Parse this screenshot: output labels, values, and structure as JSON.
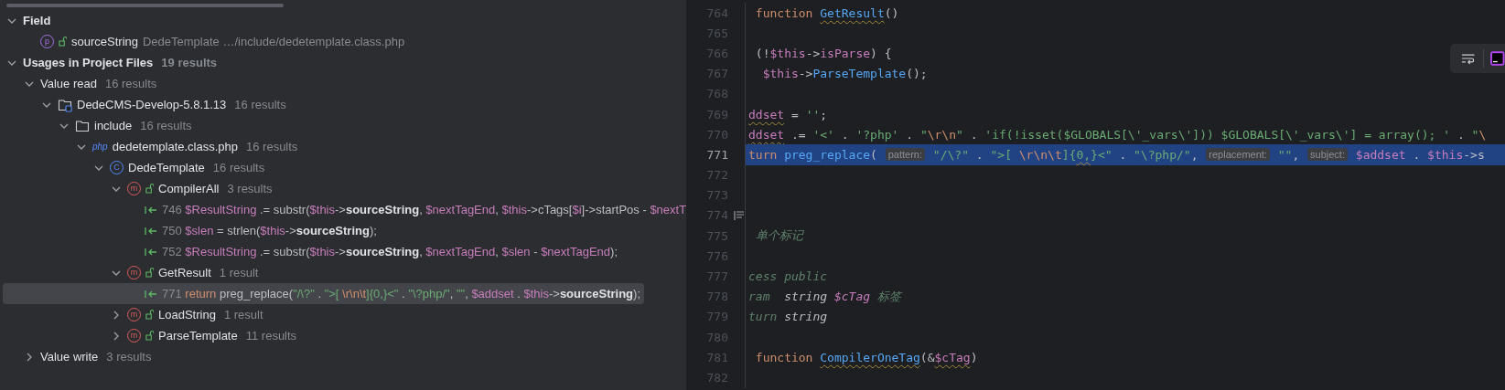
{
  "usages_tree": [
    {
      "kind": "header",
      "label": "Field",
      "expanded": true,
      "selected": false,
      "children": [
        {
          "kind": "field",
          "badge": "p",
          "label": "sourceString",
          "detail": "DedeTemplate …/include/dedetemplate.class.php",
          "selected": false
        }
      ]
    },
    {
      "kind": "header",
      "label": "Usages in Project Files",
      "count": "19 results",
      "expanded": true,
      "selected": false,
      "children": [
        {
          "kind": "group",
          "label": "Value read",
          "count": "16 results",
          "expanded": true,
          "selected": false,
          "children": [
            {
              "kind": "module",
              "label": "DedeCMS-Develop-5.8.1.13",
              "count": "16 results",
              "expanded": true,
              "selected": false,
              "children": [
                {
                  "kind": "folder",
                  "label": "include",
                  "count": "16 results",
                  "expanded": true,
                  "selected": false,
                  "children": [
                    {
                      "kind": "php-file",
                      "badge": "php",
                      "label": "dedetemplate.class.php",
                      "count": "16 results",
                      "expanded": true,
                      "selected": false,
                      "children": [
                        {
                          "kind": "class",
                          "badge": "C",
                          "label": "DedeTemplate",
                          "count": "16 results",
                          "expanded": true,
                          "selected": false,
                          "children": [
                            {
                              "kind": "method",
                              "badge": "m",
                              "label": "CompilerAll",
                              "count": "3 results",
                              "expanded": true,
                              "selected": false,
                              "children": [
                                {
                                  "kind": "usage",
                                  "line": "746",
                                  "selected": false,
                                  "tokens": [
                                    {
                                      "kind": "var",
                                      "text": "$ResultString"
                                    },
                                    {
                                      "kind": "plain",
                                      "text": " .= substr("
                                    },
                                    {
                                      "kind": "var",
                                      "text": "$this"
                                    },
                                    {
                                      "kind": "plain",
                                      "text": "->"
                                    },
                                    {
                                      "kind": "bold",
                                      "text": "sourceString"
                                    },
                                    {
                                      "kind": "plain",
                                      "text": ", "
                                    },
                                    {
                                      "kind": "var",
                                      "text": "$nextTagEnd"
                                    },
                                    {
                                      "kind": "plain",
                                      "text": ", "
                                    },
                                    {
                                      "kind": "var",
                                      "text": "$this"
                                    },
                                    {
                                      "kind": "plain",
                                      "text": "->cTags["
                                    },
                                    {
                                      "kind": "var",
                                      "text": "$i"
                                    },
                                    {
                                      "kind": "plain",
                                      "text": "]->startPos - "
                                    },
                                    {
                                      "kind": "var",
                                      "text": "$nextT"
                                    }
                                  ]
                                },
                                {
                                  "kind": "usage",
                                  "line": "750",
                                  "selected": false,
                                  "tokens": [
                                    {
                                      "kind": "var",
                                      "text": "$slen"
                                    },
                                    {
                                      "kind": "plain",
                                      "text": " = strlen("
                                    },
                                    {
                                      "kind": "var",
                                      "text": "$this"
                                    },
                                    {
                                      "kind": "plain",
                                      "text": "->"
                                    },
                                    {
                                      "kind": "bold",
                                      "text": "sourceString"
                                    },
                                    {
                                      "kind": "plain",
                                      "text": ");"
                                    }
                                  ]
                                },
                                {
                                  "kind": "usage",
                                  "line": "752",
                                  "selected": false,
                                  "tokens": [
                                    {
                                      "kind": "var",
                                      "text": "$ResultString"
                                    },
                                    {
                                      "kind": "plain",
                                      "text": " .= substr("
                                    },
                                    {
                                      "kind": "var",
                                      "text": "$this"
                                    },
                                    {
                                      "kind": "plain",
                                      "text": "->"
                                    },
                                    {
                                      "kind": "bold",
                                      "text": "sourceString"
                                    },
                                    {
                                      "kind": "plain",
                                      "text": ", "
                                    },
                                    {
                                      "kind": "var",
                                      "text": "$nextTagEnd"
                                    },
                                    {
                                      "kind": "plain",
                                      "text": ", "
                                    },
                                    {
                                      "kind": "var",
                                      "text": "$slen"
                                    },
                                    {
                                      "kind": "plain",
                                      "text": " - "
                                    },
                                    {
                                      "kind": "var",
                                      "text": "$nextTagEnd"
                                    },
                                    {
                                      "kind": "plain",
                                      "text": ");"
                                    }
                                  ]
                                }
                              ]
                            },
                            {
                              "kind": "method",
                              "badge": "m",
                              "label": "GetResult",
                              "count": "1 result",
                              "expanded": true,
                              "selected": false,
                              "children": [
                                {
                                  "kind": "usage",
                                  "line": "771",
                                  "selected": true,
                                  "tokens": [
                                    {
                                      "kind": "kw",
                                      "text": "return"
                                    },
                                    {
                                      "kind": "plain",
                                      "text": " preg_replace("
                                    },
                                    {
                                      "kind": "str",
                                      "text": "\"/\\?\""
                                    },
                                    {
                                      "kind": "plain",
                                      "text": " . "
                                    },
                                    {
                                      "kind": "str",
                                      "text": "\">[ "
                                    },
                                    {
                                      "kind": "esc",
                                      "text": "\\r\\n\\t"
                                    },
                                    {
                                      "kind": "str",
                                      "text": "]{0,}<\""
                                    },
                                    {
                                      "kind": "plain",
                                      "text": " . "
                                    },
                                    {
                                      "kind": "str",
                                      "text": "\"\\?php/\""
                                    },
                                    {
                                      "kind": "plain",
                                      "text": ", "
                                    },
                                    {
                                      "kind": "str",
                                      "text": "\"\""
                                    },
                                    {
                                      "kind": "plain",
                                      "text": ", "
                                    },
                                    {
                                      "kind": "var",
                                      "text": "$addset"
                                    },
                                    {
                                      "kind": "plain",
                                      "text": " . "
                                    },
                                    {
                                      "kind": "var",
                                      "text": "$this"
                                    },
                                    {
                                      "kind": "plain",
                                      "text": "->"
                                    },
                                    {
                                      "kind": "bold",
                                      "text": "sourceString"
                                    },
                                    {
                                      "kind": "plain",
                                      "text": ");"
                                    }
                                  ]
                                }
                              ]
                            },
                            {
                              "kind": "method",
                              "badge": "m",
                              "label": "LoadString",
                              "count": "1 result",
                              "expanded": false,
                              "selected": false
                            },
                            {
                              "kind": "method",
                              "badge": "m",
                              "label": "ParseTemplate",
                              "count": "11 results",
                              "expanded": false,
                              "selected": false
                            }
                          ]
                        }
                      ]
                    }
                  ]
                }
              ]
            }
          ]
        },
        {
          "kind": "group",
          "label": "Value write",
          "count": "3 results",
          "expanded": false,
          "selected": false
        }
      ]
    }
  ],
  "editor": {
    "lines": [
      {
        "number": "764",
        "current": false,
        "tokens": [
          {
            "kind": "kw",
            "text": " function "
          },
          {
            "kind": "fn",
            "text": "GetResult",
            "warn": true
          },
          {
            "kind": "plain",
            "text": "()"
          }
        ]
      },
      {
        "number": "765",
        "current": false
      },
      {
        "number": "766",
        "current": false,
        "tokens": [
          {
            "kind": "plain",
            "text": " (!"
          },
          {
            "kind": "var",
            "text": "$this"
          },
          {
            "kind": "plain",
            "text": "->"
          },
          {
            "kind": "var",
            "text": "isParse"
          },
          {
            "kind": "plain",
            "text": ") {"
          }
        ]
      },
      {
        "number": "767",
        "current": false,
        "tokens": [
          {
            "kind": "var",
            "text": "  $this"
          },
          {
            "kind": "plain",
            "text": "->"
          },
          {
            "kind": "fn",
            "text": "ParseTemplate"
          },
          {
            "kind": "plain",
            "text": "();"
          }
        ]
      },
      {
        "number": "768",
        "current": false
      },
      {
        "number": "769",
        "current": false,
        "tokens": [
          {
            "kind": "var",
            "text": "ddset",
            "warn": true
          },
          {
            "kind": "plain",
            "text": " = "
          },
          {
            "kind": "str",
            "text": "''"
          },
          {
            "kind": "plain",
            "text": ";"
          }
        ]
      },
      {
        "number": "770",
        "current": false,
        "tokens": [
          {
            "kind": "var",
            "text": "ddset",
            "warn": true
          },
          {
            "kind": "plain",
            "text": " .= "
          },
          {
            "kind": "str",
            "text": "'<'"
          },
          {
            "kind": "plain",
            "text": " . "
          },
          {
            "kind": "str",
            "text": "'?php'"
          },
          {
            "kind": "plain",
            "text": " . "
          },
          {
            "kind": "str",
            "text": "\""
          },
          {
            "kind": "esc",
            "text": "\\r\\n"
          },
          {
            "kind": "str",
            "text": "\""
          },
          {
            "kind": "plain",
            "text": " . "
          },
          {
            "kind": "str",
            "text": "'if(!isset($GLOBALS[\\'_vars\\'])) $GLOBALS[\\'_vars\\'] = array(); '"
          },
          {
            "kind": "plain",
            "text": " . "
          },
          {
            "kind": "str",
            "text": "\""
          },
          {
            "kind": "esc",
            "text": "\\"
          }
        ]
      },
      {
        "number": "771",
        "current": true,
        "tokens": [
          {
            "kind": "kw",
            "text": "turn "
          },
          {
            "kind": "fn",
            "text": "preg_replace"
          },
          {
            "kind": "plain",
            "text": "( "
          },
          {
            "kind": "hint",
            "text": "pattern:"
          },
          {
            "kind": "str",
            "text": " \"/\\?\""
          },
          {
            "kind": "plain",
            "text": " . "
          },
          {
            "kind": "str",
            "text": "\">[ "
          },
          {
            "kind": "esc",
            "text": "\\r\\n\\t"
          },
          {
            "kind": "str",
            "text": "]{"
          },
          {
            "kind": "str",
            "text": "0,",
            "warn": true
          },
          {
            "kind": "str",
            "text": "}<\""
          },
          {
            "kind": "plain",
            "text": " . "
          },
          {
            "kind": "str",
            "text": "\"\\?php/\""
          },
          {
            "kind": "plain",
            "text": ", "
          },
          {
            "kind": "hint",
            "text": "replacement:"
          },
          {
            "kind": "str",
            "text": " \"\""
          },
          {
            "kind": "plain",
            "text": ", "
          },
          {
            "kind": "hint",
            "text": "subject:"
          },
          {
            "kind": "var",
            "text": " $addset"
          },
          {
            "kind": "plain",
            "text": " . "
          },
          {
            "kind": "var",
            "text": "$this"
          },
          {
            "kind": "plain",
            "text": "->s"
          }
        ]
      },
      {
        "number": "772",
        "current": false
      },
      {
        "number": "773",
        "current": false
      },
      {
        "number": "774",
        "current": false,
        "doc_toggle": true
      },
      {
        "number": "775",
        "current": false,
        "tokens": [
          {
            "kind": "comment",
            "text": " 单个标记"
          }
        ]
      },
      {
        "number": "776",
        "current": false
      },
      {
        "number": "777",
        "current": false,
        "tokens": [
          {
            "kind": "comment",
            "text": "cess public"
          }
        ]
      },
      {
        "number": "778",
        "current": false,
        "tokens": [
          {
            "kind": "comment",
            "text": "ram  "
          },
          {
            "kind": "doc",
            "text": "string "
          },
          {
            "kind": "docvar",
            "text": "$cTag"
          },
          {
            "kind": "comment",
            "text": " 标签"
          }
        ]
      },
      {
        "number": "779",
        "current": false,
        "tokens": [
          {
            "kind": "comment",
            "text": "turn "
          },
          {
            "kind": "doc",
            "text": "string"
          }
        ]
      },
      {
        "number": "780",
        "current": false
      },
      {
        "number": "781",
        "current": false,
        "tokens": [
          {
            "kind": "kw",
            "text": " function "
          },
          {
            "kind": "fn",
            "text": "CompilerOneTag",
            "warn": true
          },
          {
            "kind": "plain",
            "text": "(&"
          },
          {
            "kind": "var",
            "text": "$cTag",
            "warn": true
          },
          {
            "kind": "plain",
            "text": ")"
          }
        ]
      },
      {
        "number": "782",
        "current": false
      }
    ]
  }
}
